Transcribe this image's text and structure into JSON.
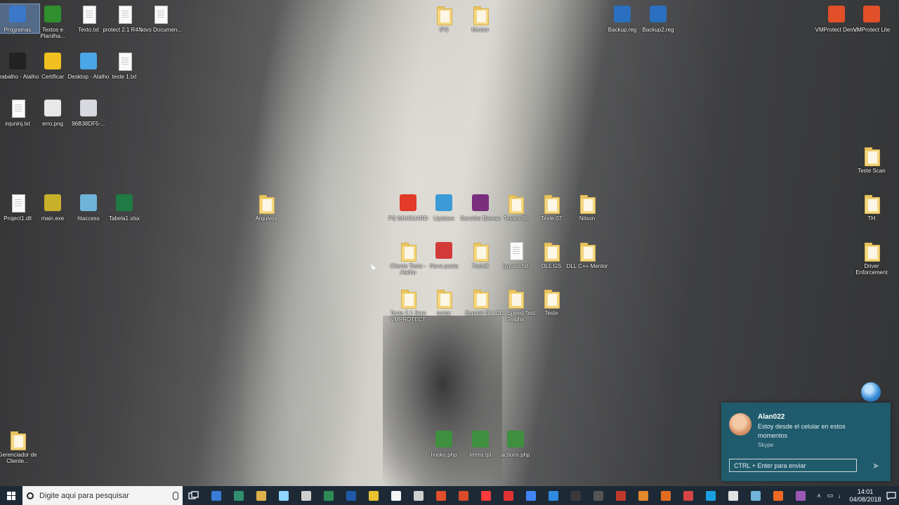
{
  "desktop": {
    "icons": [
      {
        "label": "Programas",
        "type": "app",
        "color": "#3b78c9",
        "selected": true
      },
      {
        "label": "Textos e Planilha...",
        "type": "app",
        "color": "#2f8f2f"
      },
      {
        "label": "Texto.txt",
        "type": "doc"
      },
      {
        "label": "protect 2.1 R4.txt",
        "type": "doc"
      },
      {
        "label": "Novo Documen...",
        "type": "doc"
      },
      {
        "label": "IPS",
        "type": "folder"
      },
      {
        "label": "Mentor",
        "type": "folder"
      },
      {
        "label": "Backup.reg",
        "type": "app",
        "color": "#2a6fc0"
      },
      {
        "label": "Backup2.reg",
        "type": "app",
        "color": "#2a6fc0"
      },
      {
        "label": "VMProtect Demo",
        "type": "app",
        "color": "#e2502a"
      },
      {
        "label": "VMProtect Lite",
        "type": "app",
        "color": "#e2502a"
      },
      {
        "label": "Trabalho - Atalho",
        "type": "app",
        "color": "#222222"
      },
      {
        "label": "Certificar",
        "type": "app",
        "color": "#f0c020"
      },
      {
        "label": "Desktop - Atalho",
        "type": "app",
        "color": "#4aa6e6"
      },
      {
        "label": "teste 1.txt",
        "type": "doc"
      },
      {
        "label": "injuninj.txt",
        "type": "doc"
      },
      {
        "label": "erro.png",
        "type": "app",
        "color": "#e8e8e8"
      },
      {
        "label": "96B38DF5-...",
        "type": "app",
        "color": "#d8d8e0"
      },
      {
        "label": "Teste Scan",
        "type": "folder"
      },
      {
        "label": "Project1.dll",
        "type": "doc"
      },
      {
        "label": "main.exe",
        "type": "app",
        "color": "#c8b12a"
      },
      {
        "label": "htaccess",
        "type": "app",
        "color": "#6fb3d9"
      },
      {
        "label": "Tabela1.xlsx",
        "type": "app",
        "color": "#1f7a43"
      },
      {
        "label": "Arquivos",
        "type": "folder"
      },
      {
        "label": "PS IMUGUARD",
        "type": "app",
        "color": "#e23b2a"
      },
      {
        "label": "Updates",
        "type": "app",
        "color": "#3c9ad6"
      },
      {
        "label": "Servidor Basear",
        "type": "app",
        "color": "#7a2e7e"
      },
      {
        "label": "Testes 06",
        "type": "folder"
      },
      {
        "label": "Teste 07",
        "type": "folder"
      },
      {
        "label": "Nilson",
        "type": "folder"
      },
      {
        "label": "TH",
        "type": "folder"
      },
      {
        "label": "Cliente Teste - Atalho",
        "type": "folder"
      },
      {
        "label": "Nova pasta",
        "type": "app",
        "color": "#d23a3a"
      },
      {
        "label": "TesteX",
        "type": "folder"
      },
      {
        "label": "bypass.txt",
        "type": "doc"
      },
      {
        "label": "DLL GS",
        "type": "folder"
      },
      {
        "label": "DLL C++ Mentor",
        "type": "folder"
      },
      {
        "label": "Driver Enforcement",
        "type": "folder"
      },
      {
        "label": "Teste 2.1 Sem VMPROTECT",
        "type": "folder"
      },
      {
        "label": "testar",
        "type": "folder"
      },
      {
        "label": "Bypass DLL",
        "type": "folder"
      },
      {
        "label": "DLL Speed Test Graphic",
        "type": "folder"
      },
      {
        "label": "Teste",
        "type": "folder"
      },
      {
        "label": "hooks.php",
        "type": "app",
        "color": "#3e8f3e"
      },
      {
        "label": "terms.tpl",
        "type": "app",
        "color": "#3e8f3e"
      },
      {
        "label": "actions.php",
        "type": "app",
        "color": "#3e8f3e"
      },
      {
        "label": "Gerenciador de Cliente...",
        "type": "folder"
      }
    ]
  },
  "taskbar": {
    "search_placeholder": "Digite aqui para pesquisar",
    "apps": [
      "#3a7bd5",
      "#2f8f6f",
      "#e0b24a",
      "#8fd3ff",
      "#cfcfcf",
      "#2e8b57",
      "#1e5aa8",
      "#e8c230",
      "#f5f5f5",
      "#cfcfcf",
      "#e0502a",
      "#d84a2a",
      "#ff3b3b",
      "#e23333",
      "#4285f4",
      "#2f8ae0",
      "#3a3a3a",
      "#555555",
      "#c0392b",
      "#e08a2a",
      "#e06d1f",
      "#d64545",
      "#1aa0e0",
      "#e2e2e2",
      "#6fb3d9",
      "#f06a23",
      "#9b59b6"
    ],
    "clock_time": "14:01",
    "clock_date": "04/08/2018"
  },
  "toast": {
    "sender": "Alan022",
    "message": "Estoy desde el celular en estos momentos",
    "app_name": "Skype",
    "reply_placeholder": "CTRL + Enter para enviar"
  }
}
